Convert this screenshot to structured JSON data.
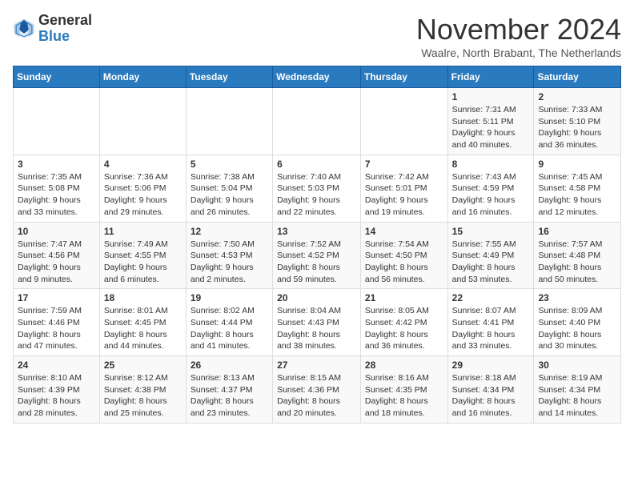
{
  "header": {
    "logo_general": "General",
    "logo_blue": "Blue",
    "month_title": "November 2024",
    "location": "Waalre, North Brabant, The Netherlands"
  },
  "weekdays": [
    "Sunday",
    "Monday",
    "Tuesday",
    "Wednesday",
    "Thursday",
    "Friday",
    "Saturday"
  ],
  "weeks": [
    [
      {
        "day": "",
        "info": ""
      },
      {
        "day": "",
        "info": ""
      },
      {
        "day": "",
        "info": ""
      },
      {
        "day": "",
        "info": ""
      },
      {
        "day": "",
        "info": ""
      },
      {
        "day": "1",
        "info": "Sunrise: 7:31 AM\nSunset: 5:11 PM\nDaylight: 9 hours and 40 minutes."
      },
      {
        "day": "2",
        "info": "Sunrise: 7:33 AM\nSunset: 5:10 PM\nDaylight: 9 hours and 36 minutes."
      }
    ],
    [
      {
        "day": "3",
        "info": "Sunrise: 7:35 AM\nSunset: 5:08 PM\nDaylight: 9 hours and 33 minutes."
      },
      {
        "day": "4",
        "info": "Sunrise: 7:36 AM\nSunset: 5:06 PM\nDaylight: 9 hours and 29 minutes."
      },
      {
        "day": "5",
        "info": "Sunrise: 7:38 AM\nSunset: 5:04 PM\nDaylight: 9 hours and 26 minutes."
      },
      {
        "day": "6",
        "info": "Sunrise: 7:40 AM\nSunset: 5:03 PM\nDaylight: 9 hours and 22 minutes."
      },
      {
        "day": "7",
        "info": "Sunrise: 7:42 AM\nSunset: 5:01 PM\nDaylight: 9 hours and 19 minutes."
      },
      {
        "day": "8",
        "info": "Sunrise: 7:43 AM\nSunset: 4:59 PM\nDaylight: 9 hours and 16 minutes."
      },
      {
        "day": "9",
        "info": "Sunrise: 7:45 AM\nSunset: 4:58 PM\nDaylight: 9 hours and 12 minutes."
      }
    ],
    [
      {
        "day": "10",
        "info": "Sunrise: 7:47 AM\nSunset: 4:56 PM\nDaylight: 9 hours and 9 minutes."
      },
      {
        "day": "11",
        "info": "Sunrise: 7:49 AM\nSunset: 4:55 PM\nDaylight: 9 hours and 6 minutes."
      },
      {
        "day": "12",
        "info": "Sunrise: 7:50 AM\nSunset: 4:53 PM\nDaylight: 9 hours and 2 minutes."
      },
      {
        "day": "13",
        "info": "Sunrise: 7:52 AM\nSunset: 4:52 PM\nDaylight: 8 hours and 59 minutes."
      },
      {
        "day": "14",
        "info": "Sunrise: 7:54 AM\nSunset: 4:50 PM\nDaylight: 8 hours and 56 minutes."
      },
      {
        "day": "15",
        "info": "Sunrise: 7:55 AM\nSunset: 4:49 PM\nDaylight: 8 hours and 53 minutes."
      },
      {
        "day": "16",
        "info": "Sunrise: 7:57 AM\nSunset: 4:48 PM\nDaylight: 8 hours and 50 minutes."
      }
    ],
    [
      {
        "day": "17",
        "info": "Sunrise: 7:59 AM\nSunset: 4:46 PM\nDaylight: 8 hours and 47 minutes."
      },
      {
        "day": "18",
        "info": "Sunrise: 8:01 AM\nSunset: 4:45 PM\nDaylight: 8 hours and 44 minutes."
      },
      {
        "day": "19",
        "info": "Sunrise: 8:02 AM\nSunset: 4:44 PM\nDaylight: 8 hours and 41 minutes."
      },
      {
        "day": "20",
        "info": "Sunrise: 8:04 AM\nSunset: 4:43 PM\nDaylight: 8 hours and 38 minutes."
      },
      {
        "day": "21",
        "info": "Sunrise: 8:05 AM\nSunset: 4:42 PM\nDaylight: 8 hours and 36 minutes."
      },
      {
        "day": "22",
        "info": "Sunrise: 8:07 AM\nSunset: 4:41 PM\nDaylight: 8 hours and 33 minutes."
      },
      {
        "day": "23",
        "info": "Sunrise: 8:09 AM\nSunset: 4:40 PM\nDaylight: 8 hours and 30 minutes."
      }
    ],
    [
      {
        "day": "24",
        "info": "Sunrise: 8:10 AM\nSunset: 4:39 PM\nDaylight: 8 hours and 28 minutes."
      },
      {
        "day": "25",
        "info": "Sunrise: 8:12 AM\nSunset: 4:38 PM\nDaylight: 8 hours and 25 minutes."
      },
      {
        "day": "26",
        "info": "Sunrise: 8:13 AM\nSunset: 4:37 PM\nDaylight: 8 hours and 23 minutes."
      },
      {
        "day": "27",
        "info": "Sunrise: 8:15 AM\nSunset: 4:36 PM\nDaylight: 8 hours and 20 minutes."
      },
      {
        "day": "28",
        "info": "Sunrise: 8:16 AM\nSunset: 4:35 PM\nDaylight: 8 hours and 18 minutes."
      },
      {
        "day": "29",
        "info": "Sunrise: 8:18 AM\nSunset: 4:34 PM\nDaylight: 8 hours and 16 minutes."
      },
      {
        "day": "30",
        "info": "Sunrise: 8:19 AM\nSunset: 4:34 PM\nDaylight: 8 hours and 14 minutes."
      }
    ]
  ]
}
